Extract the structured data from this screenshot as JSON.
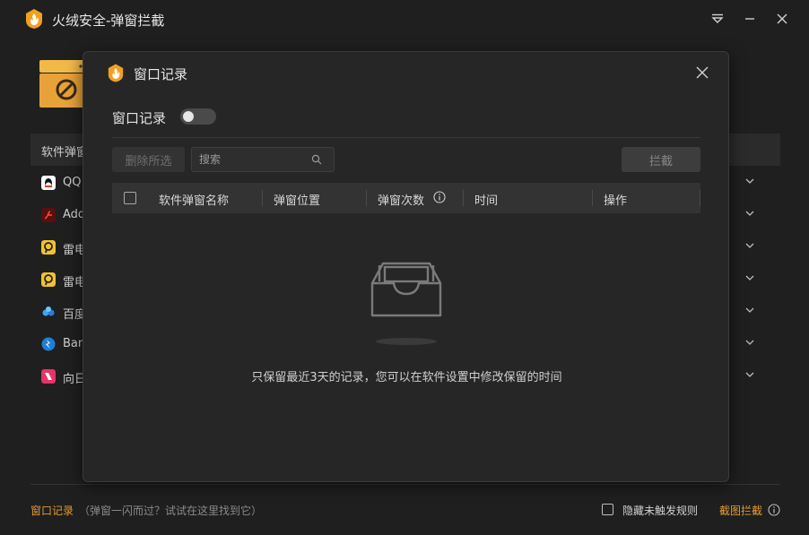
{
  "window": {
    "title": "火绒安全-弹窗拦截"
  },
  "list": {
    "header_label": "软件弹窗",
    "rows": [
      {
        "label": "QQ",
        "icon": "qq-icon",
        "color": "#ffffff"
      },
      {
        "label": "Ado",
        "icon": "adobe-icon",
        "color": "#8b1a1a"
      },
      {
        "label": "雷电",
        "icon": "leidian-icon",
        "color": "#f2c230"
      },
      {
        "label": "雷电",
        "icon": "leidian-icon",
        "color": "#f2c230"
      },
      {
        "label": "百度",
        "icon": "baidu-netdisk-icon",
        "color": "#2e7bd6"
      },
      {
        "label": "Ban",
        "icon": "bandizip-icon",
        "color": "#1f7fd6"
      },
      {
        "label": "向日",
        "icon": "sunlogin-icon",
        "color": "#e8336b"
      }
    ]
  },
  "footer": {
    "record_link": "窗口记录",
    "hint": "（弹窗一闪而过？试试在这里找到它）",
    "hide_label": "隐藏未触发规则",
    "screenshot_link": "截图拦截"
  },
  "modal": {
    "title": "窗口记录",
    "toggle_label": "窗口记录",
    "toggle_on": false,
    "delete_button": "删除所选",
    "search_placeholder": "搜索",
    "block_button": "拦截",
    "columns": [
      "软件弹窗名称",
      "弹窗位置",
      "弹窗次数",
      "时间",
      "操作"
    ],
    "empty_text": "只保留最近3天的记录，您可以在软件设置中修改保留的时间"
  },
  "colors": {
    "accent": "#e39b2f",
    "background": "#1f1f1f",
    "modal_bg": "#262626"
  }
}
